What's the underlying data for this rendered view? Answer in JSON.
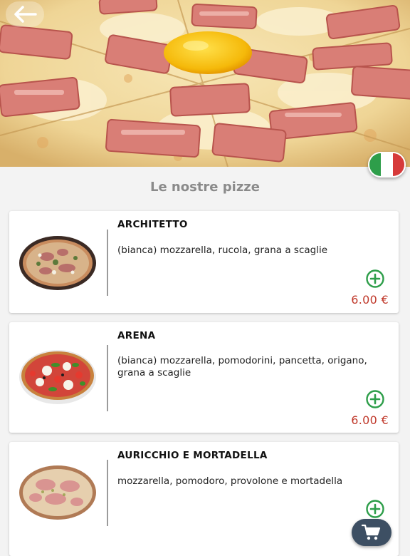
{
  "header": {
    "back_icon": "arrow-left-icon",
    "language_flag": "italy-flag-icon",
    "flag_colors": [
      "#2e9e4a",
      "#ffffff",
      "#d63a3a"
    ]
  },
  "section_title": "Le nostre pizze",
  "pizzas": [
    {
      "name": "ARCHITETTO",
      "description": "(bianca) mozzarella, rucola, grana a scaglie",
      "price": "6.00 €"
    },
    {
      "name": "ARENA",
      "description": "(bianca) mozzarella, pomodorini, pancetta, origano, grana a scaglie",
      "price": "6.00 €"
    },
    {
      "name": "AURICCHIO E MORTADELLA",
      "description": "mozzarella, pomodoro, provolone e mortadella",
      "price": ""
    }
  ],
  "add_icon": "plus-circle-icon",
  "cart_icon": "shopping-cart-icon",
  "colors": {
    "accent_green": "#2e9e4a",
    "price_red": "#c0392b",
    "cart_bg": "#3d4f63"
  }
}
